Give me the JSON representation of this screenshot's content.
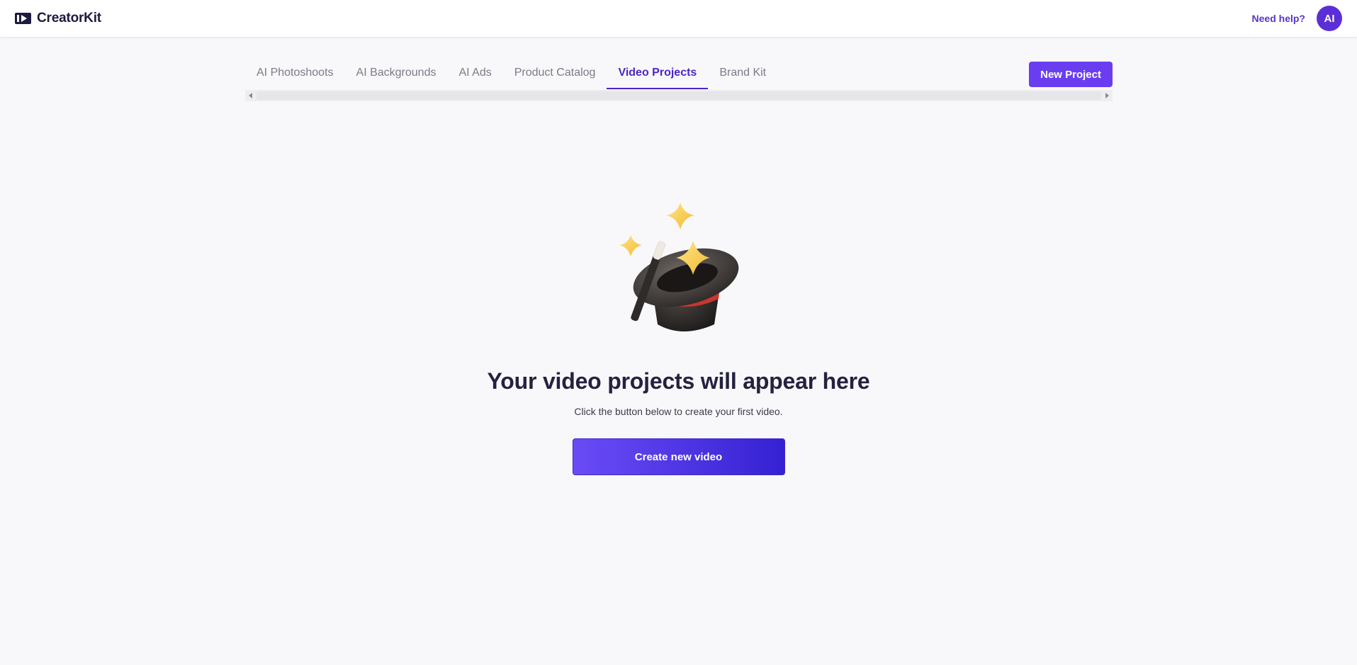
{
  "header": {
    "brand_name": "CreatorKit",
    "help_label": "Need help?",
    "avatar_initials": "AI"
  },
  "tabs": [
    {
      "label": "AI Photoshoots",
      "active": false
    },
    {
      "label": "AI Backgrounds",
      "active": false
    },
    {
      "label": "AI Ads",
      "active": false
    },
    {
      "label": "Product Catalog",
      "active": false
    },
    {
      "label": "Video Projects",
      "active": true
    },
    {
      "label": "Brand Kit",
      "active": false
    }
  ],
  "toolbar": {
    "new_project_label": "New Project"
  },
  "empty_state": {
    "illustration_icon": "magic-hat-wand-sparkles-icon",
    "title": "Your video projects will appear here",
    "subtitle": "Click the button below to create your first video.",
    "cta_label": "Create new video"
  },
  "colors": {
    "accent": "#5a34c8",
    "active_tab": "#4a28c4",
    "button_primary": "#6a3ef0",
    "gradient_start": "#6a4cf6",
    "gradient_end": "#3521d3",
    "background": "#f8f8fa"
  }
}
